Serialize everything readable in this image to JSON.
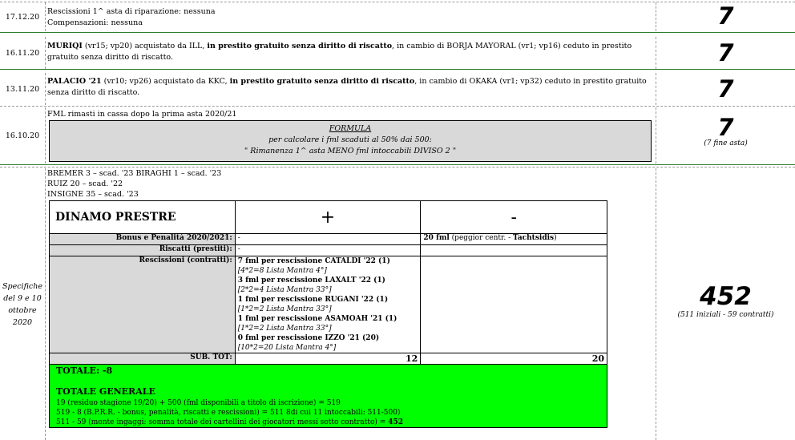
{
  "rows": [
    {
      "date": "17.12.20",
      "lines": [
        "Rescissioni 1^ asta di riparazione: nessuna",
        "Compensazioni: nessuna"
      ],
      "score": "7"
    },
    {
      "date": "16.11.20",
      "p1": "MURIQI",
      "p2": " (vr15; vp20) acquistato da ILL, ",
      "p3": "in prestito gratuito senza diritto di riscatto",
      "p4": ", in cambio di BORJA MAYORAL (vr1; vp16) ceduto in prestito gratuito senza diritto di riscatto.",
      "score": "7"
    },
    {
      "date": "13.11.20",
      "p1": "PALACIO '21",
      "p2": " (vr10; vp26) acquistato da KKC, ",
      "p3": "in prestito gratuito senza diritto di riscatto",
      "p4": ", in cambio di OKAKA (vr1; vp32) ceduto in prestito gratuito senza diritto di riscatto.",
      "score": "7"
    },
    {
      "date": "16.10.20",
      "intro": "FML rimasti in cassa dopo la prima asta 2020/21",
      "formula_title": "FORMULA",
      "formula_l1": "per calcolare i fml scaduti al 50% dai 500:",
      "formula_l2": "\" Rimanenza 1^ asta MENO fml intoccabili DIVISO 2 \"",
      "score": "7",
      "score_note": "(7 fine asta)"
    }
  ],
  "spec": {
    "date_l1": "Specifiche",
    "date_l2": "del 9 e 10",
    "date_l3": "ottobre",
    "date_l4": "2020",
    "players": [
      "BREMER 3 – scad. '23   BIRAGHI 1 – scad. '23",
      "RUIZ 20 – scad. '22",
      "INSIGNE 35 – scad. '23"
    ],
    "score": "452",
    "score_note": "(511 iniziali - 59 contratti)",
    "table": {
      "team": "DINAMO PRESTRE",
      "plus": "+",
      "minus": "-",
      "bonus_label": "Bonus e Penalità 2020/2021:",
      "bonus_plus": "-",
      "bonus_minus_b": "20 fml",
      "bonus_minus_n": " (peggior centr. - ",
      "bonus_minus_e": "Tachtsidis",
      "riscatti_label": "Riscatti (prestiti):",
      "riscatti_plus": "-",
      "resc_label": "Rescissioni (contratti):",
      "resc": [
        {
          "b": "7 fml per rescissione CATALDI '22 (1)",
          "i": "[4*2=8 Lista Mantra 4°]"
        },
        {
          "b": "3 fml per rescissione LAXALT '22 (1)",
          "i": "[2*2=4 Lista Mantra 33°]"
        },
        {
          "b": "1 fml per rescissione RUGANI '22 (1)",
          "i": "[1*2=2 Lista Mantra 33°]"
        },
        {
          "b": "1 fml per rescissione ASAMOAH '21 (1)",
          "i": "[1*2=2 Lista Mantra 33°]"
        },
        {
          "b": "0 fml per rescissione IZZO '21 (20)",
          "i": "[10*2=20 Lista Mantra 4°]"
        }
      ],
      "subtot_label": "SUB. TOT:",
      "subtot_plus": "12",
      "subtot_minus": "20",
      "totale": "TOTALE: -8",
      "totale_generale": "TOTALE GENERALE",
      "g1": "19 (residuo stagione 19/20) + 500 (fml disponibili a titolo di iscrizione) = 519",
      "g2": "519 - 8 (B.P.R.R. - bonus, penalità, riscatti e rescissioni) = 511 8di cui 11 intoccabili: 511-500)",
      "g3a": "511 - 59 (monte ingaggi: somma totale dei cartellini dei giocatori messi sotto contratto) = ",
      "g3b": "452"
    }
  }
}
